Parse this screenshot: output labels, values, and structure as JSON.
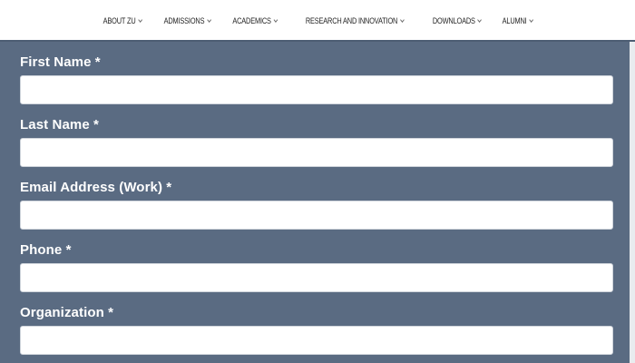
{
  "nav": {
    "items": [
      {
        "label": "ABOUT ZU"
      },
      {
        "label": "ADMISSIONS"
      },
      {
        "label": "ACADEMICS"
      },
      {
        "label": "RESEARCH AND INNOVATION"
      },
      {
        "label": "DOWNLOADS"
      },
      {
        "label": "ALUMNI"
      }
    ],
    "dropdown_icon": "chevron-down-icon"
  },
  "form": {
    "panel_color": "#5a6b82",
    "fields": [
      {
        "label": "First Name *",
        "value": "",
        "placeholder": ""
      },
      {
        "label": "Last Name *",
        "value": "",
        "placeholder": ""
      },
      {
        "label": "Email Address (Work) *",
        "value": "",
        "placeholder": ""
      },
      {
        "label": "Phone *",
        "value": "",
        "placeholder": ""
      },
      {
        "label": "Organization *",
        "value": "",
        "placeholder": ""
      }
    ]
  }
}
